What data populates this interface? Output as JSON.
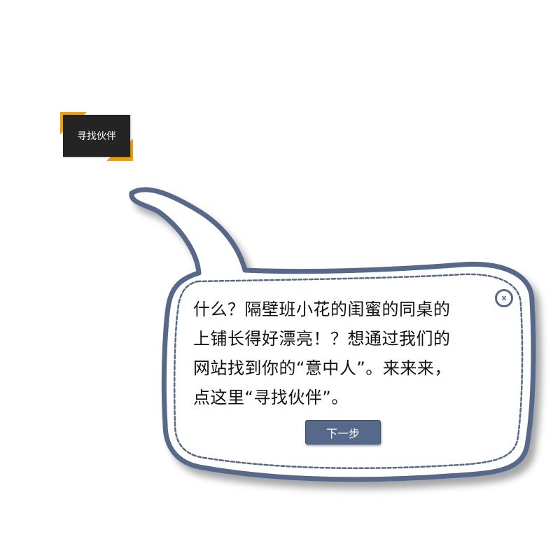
{
  "toolbar": {
    "find_partner_label": "寻找伙伴"
  },
  "bubble": {
    "lines": [
      "什么？隔壁班小花的闺蜜的同桌的",
      "上铺长得好漂亮！？想通过我们的",
      "网站找到你的“意中人”。来来来，",
      "点这里“寻找伙伴”。"
    ],
    "close_label": "x",
    "next_label": "下一步"
  },
  "colors": {
    "bubble_border": "#56698a",
    "button_bg": "#56698a",
    "tag_bg": "#242424",
    "tag_accent": "#f2a100"
  },
  "icons": {
    "close": "close-icon",
    "corner": "corner-accent-icon"
  }
}
